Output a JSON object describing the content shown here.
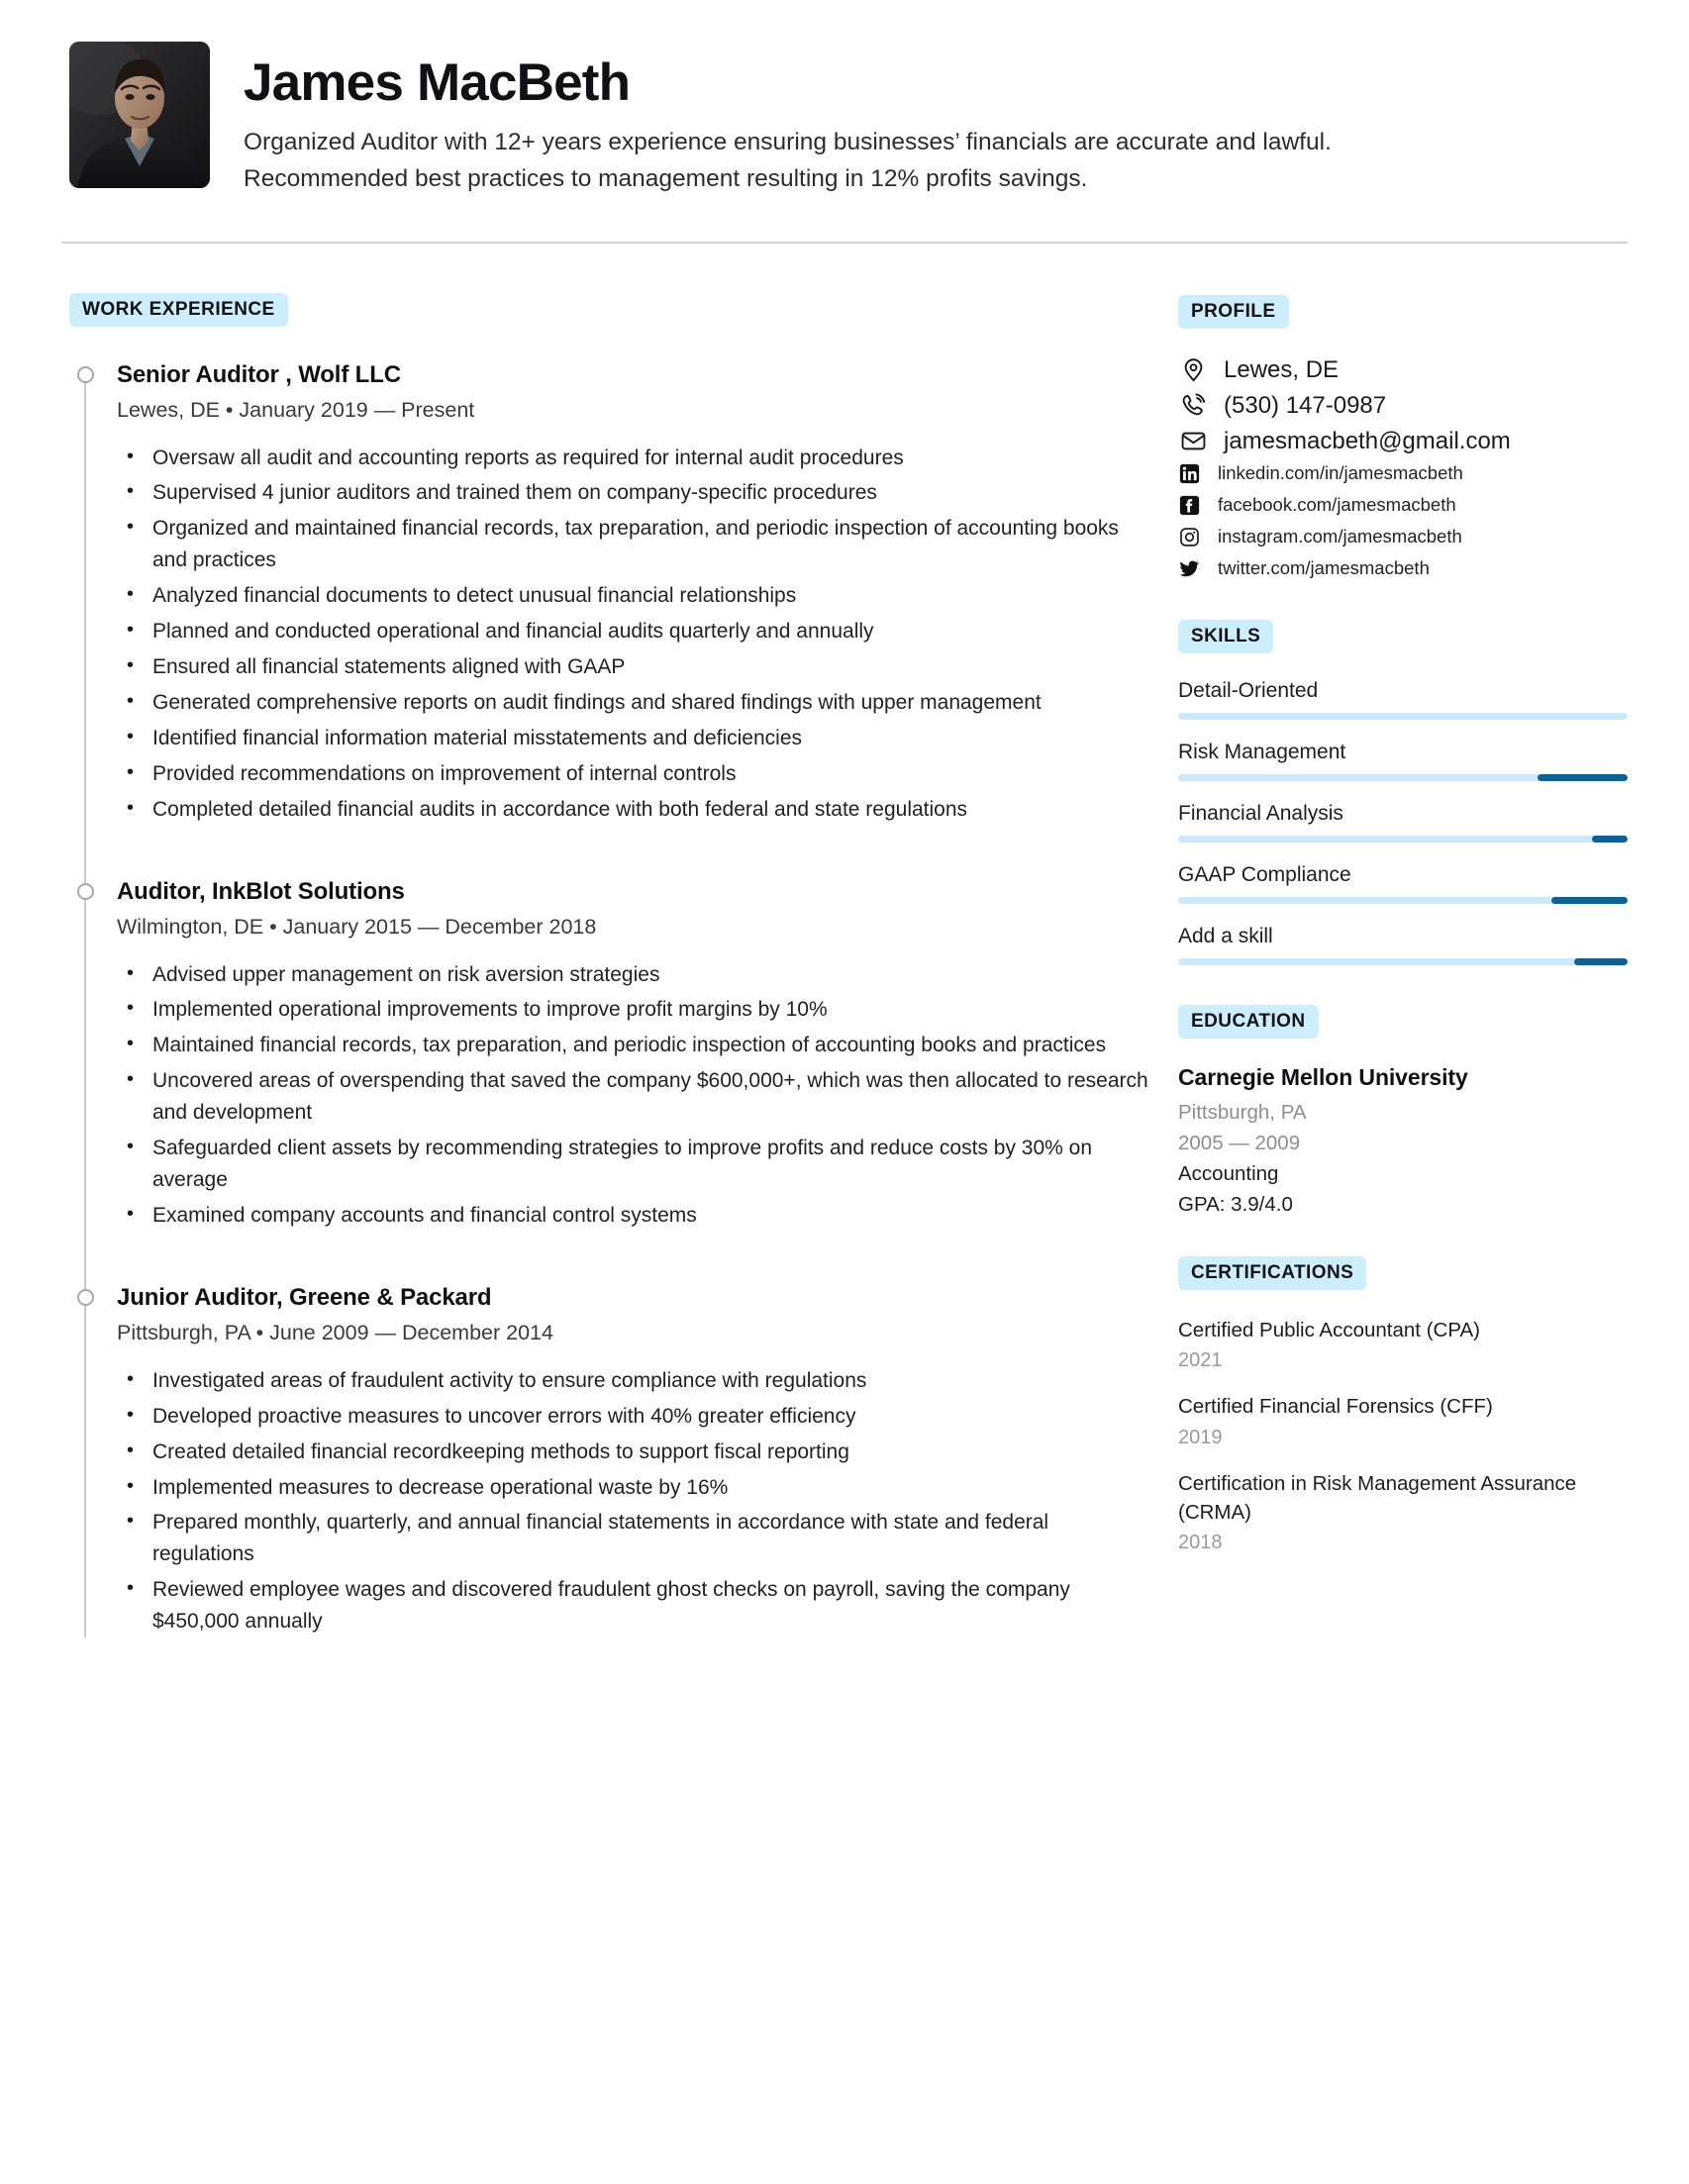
{
  "header": {
    "name": "James MacBeth",
    "summary": "Organized Auditor with 12+ years experience ensuring businesses’ financials are accurate and lawful. Recommended best practices to management resulting in 12% profits savings.",
    "avatar_alt": "portrait-photo"
  },
  "work": {
    "section_label": "WORK EXPERIENCE",
    "jobs": [
      {
        "title": "Senior Auditor , Wolf LLC",
        "meta": "Lewes, DE • January 2019 — Present",
        "bullets": [
          "Oversaw all audit and accounting reports as required for internal audit procedures",
          "Supervised 4 junior auditors and trained them on company-specific procedures",
          "Organized and maintained financial records, tax preparation, and periodic inspection of accounting books and practices",
          "Analyzed financial documents to detect unusual financial relationships",
          "Planned and conducted  operational and financial audits quarterly and annually",
          "Ensured all financial statements aligned with GAAP",
          "Generated comprehensive reports on audit findings and shared findings with upper management",
          "Identified financial information material misstatements and deficiencies",
          "Provided recommendations on improvement of internal controls",
          "Completed detailed financial audits in accordance with both federal and state regulations"
        ]
      },
      {
        "title": "Auditor, InkBlot Solutions",
        "meta": "Wilmington, DE • January 2015 — December 2018",
        "bullets": [
          "Advised upper management on risk aversion strategies",
          "Implemented operational improvements to improve profit margins by 10%",
          "Maintained financial records, tax preparation, and periodic inspection of accounting books and practices",
          "Uncovered areas of overspending that saved the company $600,000+, which was then allocated to research and development",
          "Safeguarded client assets by recommending strategies to improve profits and reduce costs by 30% on average",
          "Examined company accounts and financial control systems"
        ]
      },
      {
        "title": "Junior Auditor, Greene & Packard",
        "meta": "Pittsburgh, PA • June 2009 — December 2014",
        "bullets": [
          "Investigated areas of fraudulent activity to ensure compliance with regulations",
          "Developed proactive measures to uncover errors with 40% greater efficiency",
          "Created detailed financial recordkeeping methods to support fiscal reporting",
          "Implemented measures to decrease operational waste by 16%",
          "Prepared monthly, quarterly, and annual financial statements in accordance with state and federal regulations",
          "Reviewed employee wages and discovered fraudulent ghost checks on payroll, saving the company $450,000 annually"
        ]
      }
    ]
  },
  "profile": {
    "section_label": "PROFILE",
    "items": [
      {
        "icon": "location-pin-icon",
        "text": "Lewes, DE",
        "size": "large"
      },
      {
        "icon": "phone-icon",
        "text": "(530) 147-0987",
        "size": "large"
      },
      {
        "icon": "envelope-icon",
        "text": "jamesmacbeth@gmail.com",
        "size": "large"
      },
      {
        "icon": "linkedin-icon",
        "text": "linkedin.com/in/jamesmacbeth",
        "size": "small"
      },
      {
        "icon": "facebook-icon",
        "text": "facebook.com/jamesmacbeth",
        "size": "small"
      },
      {
        "icon": "instagram-icon",
        "text": "instagram.com/jamesmacbeth",
        "size": "small"
      },
      {
        "icon": "twitter-icon",
        "text": "twitter.com/jamesmacbeth",
        "size": "small"
      }
    ]
  },
  "skills": {
    "section_label": "SKILLS",
    "items": [
      {
        "name": "Detail-Oriented",
        "fill_percent": 0
      },
      {
        "name": "Risk Management",
        "fill_percent": 20
      },
      {
        "name": "Financial Analysis",
        "fill_percent": 8
      },
      {
        "name": "GAAP Compliance",
        "fill_percent": 17
      },
      {
        "name": "Add a skill",
        "fill_percent": 12
      }
    ],
    "track_color": "#cbe9fa",
    "fill_color": "#125f94"
  },
  "education": {
    "section_label": "EDUCATION",
    "school": "Carnegie Mellon University",
    "location": "Pittsburgh, PA",
    "years": "2005 — 2009",
    "major": "Accounting",
    "gpa": "GPA: 3.9/4.0"
  },
  "certifications": {
    "section_label": "CERTIFICATIONS",
    "items": [
      {
        "name": "Certified Public Accountant (CPA)",
        "year": "2021"
      },
      {
        "name": "Certified Financial Forensics (CFF)",
        "year": "2019"
      },
      {
        "name": "Certification in Risk Management Assurance (CRMA)",
        "year": "2018"
      }
    ]
  },
  "colors": {
    "badge_bg": "#cdeeff",
    "rule": "#d4d4d6",
    "timeline": "#c9c9cb",
    "muted_text": "#9a9a9c"
  }
}
